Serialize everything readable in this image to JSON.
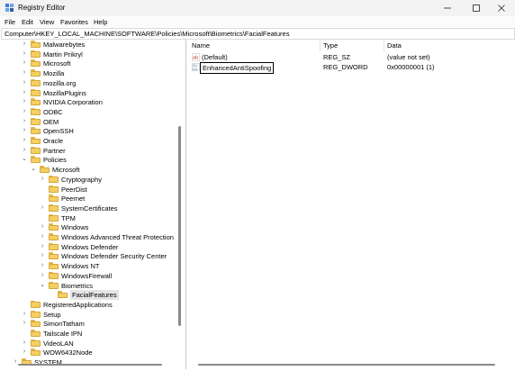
{
  "window": {
    "title": "Registry Editor"
  },
  "menu": [
    "File",
    "Edit",
    "View",
    "Favorites",
    "Help"
  ],
  "address": "Computer\\HKEY_LOCAL_MACHINE\\SOFTWARE\\Policies\\Microsoft\\Biometrics\\FacialFeatures",
  "tree": [
    {
      "label": "Malwarebytes",
      "expander": "right",
      "level": 0
    },
    {
      "label": "Martin Prikryl",
      "expander": "right",
      "level": 0
    },
    {
      "label": "Microsoft",
      "expander": "right",
      "level": 0
    },
    {
      "label": "Mozilla",
      "expander": "right",
      "level": 0
    },
    {
      "label": "mozilla.org",
      "expander": "right",
      "level": 0
    },
    {
      "label": "MozillaPlugins",
      "expander": "right",
      "level": 0
    },
    {
      "label": "NVIDIA Corporation",
      "expander": "right",
      "level": 0
    },
    {
      "label": "ODBC",
      "expander": "right",
      "level": 0
    },
    {
      "label": "OEM",
      "expander": "right",
      "level": 0
    },
    {
      "label": "OpenSSH",
      "expander": "right",
      "level": 0
    },
    {
      "label": "Oracle",
      "expander": "right",
      "level": 0
    },
    {
      "label": "Partner",
      "expander": "right",
      "level": 0
    },
    {
      "label": "Policies",
      "expander": "down",
      "level": 0
    },
    {
      "label": "Microsoft",
      "expander": "down",
      "level": 1
    },
    {
      "label": "Cryptography",
      "expander": "right",
      "level": 2
    },
    {
      "label": "PeerDist",
      "expander": "none",
      "level": 2
    },
    {
      "label": "Peernet",
      "expander": "none",
      "level": 2
    },
    {
      "label": "SystemCertificates",
      "expander": "right",
      "level": 2
    },
    {
      "label": "TPM",
      "expander": "none",
      "level": 2
    },
    {
      "label": "Windows",
      "expander": "right",
      "level": 2
    },
    {
      "label": "Windows Advanced Threat Protection",
      "expander": "right",
      "level": 2
    },
    {
      "label": "Windows Defender",
      "expander": "right",
      "level": 2
    },
    {
      "label": "Windows Defender Security Center",
      "expander": "right",
      "level": 2
    },
    {
      "label": "Windows NT",
      "expander": "right",
      "level": 2
    },
    {
      "label": "WindowsFirewall",
      "expander": "right",
      "level": 2
    },
    {
      "label": "Biometrics",
      "expander": "down",
      "level": 2
    },
    {
      "label": "FacialFeatures",
      "expander": "none",
      "level": 3,
      "selected": true
    },
    {
      "label": "RegisteredApplications",
      "expander": "none",
      "level": 0
    },
    {
      "label": "Setup",
      "expander": "right",
      "level": 0
    },
    {
      "label": "SimonTatham",
      "expander": "right",
      "level": 0
    },
    {
      "label": "Tailscale IPN",
      "expander": "none",
      "level": 0
    },
    {
      "label": "VideoLAN",
      "expander": "right",
      "level": 0
    },
    {
      "label": "WOW6432Node",
      "expander": "right",
      "level": 0
    },
    {
      "label": "SYSTEM",
      "expander": "right",
      "level": -1
    }
  ],
  "list": {
    "columns": [
      "Name",
      "Type",
      "Data"
    ],
    "rows": [
      {
        "icon": "string-value-icon",
        "name": "(Default)",
        "type": "REG_SZ",
        "data": "(value not set)",
        "editing": false
      },
      {
        "icon": "binary-value-icon",
        "name": "EnhancedAntiSpoofing",
        "type": "REG_DWORD",
        "data": "0x00000001 (1)",
        "editing": true
      }
    ]
  },
  "colors": {
    "folder": "#f6cf63",
    "selected_bg": "#e5e5e5",
    "string_icon": "#c4302b",
    "dword_icon": "#3b6fb6"
  }
}
